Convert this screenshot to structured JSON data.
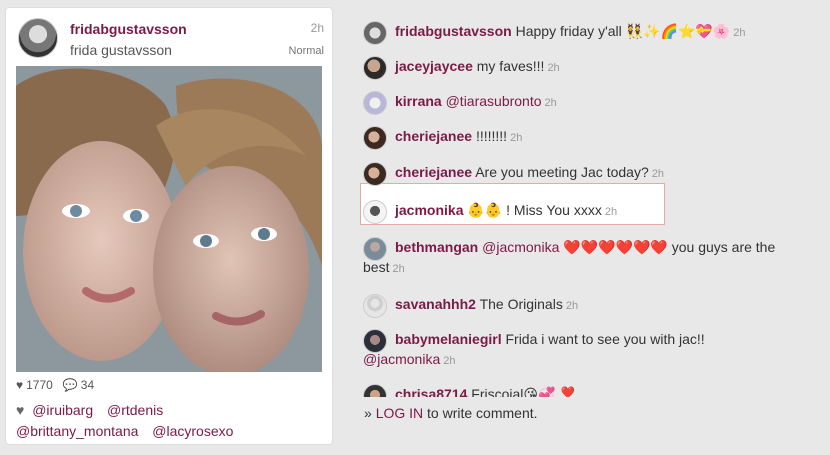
{
  "post": {
    "username": "fridabgustavsson",
    "fullname": "frida gustavsson",
    "time": "2h",
    "filter": "Normal",
    "likes_count": "1770",
    "comments_count": "34",
    "liked_by": [
      "@iruibarg",
      "@rtdenis",
      "@brittany_montana",
      "@lacyrosexo"
    ]
  },
  "comments": [
    {
      "user": "fridabgustavsson",
      "text": "Happy friday y'all 👯✨🌈⭐💝🌸",
      "time": "2h"
    },
    {
      "user": "jaceyjaycee",
      "text": "my faves!!!",
      "time": "2h"
    },
    {
      "user": "kirrana",
      "mention": "@tiarasubronto",
      "text": "",
      "time": "2h"
    },
    {
      "user": "cheriejanee",
      "text": "!!!!!!!!",
      "time": "2h"
    },
    {
      "user": "cheriejanee",
      "text": "Are you meeting Jac today?",
      "time": "2h"
    },
    {
      "user": "jacmonika",
      "text": "👶👶 ! Miss You xxxx",
      "time": "2h"
    },
    {
      "user": "bethmangan",
      "mention": "@jacmonika",
      "text": "❤️❤️❤️❤️❤️❤️ you guys are the",
      "text2": "best",
      "time": "2h"
    },
    {
      "user": "savanahhh2",
      "text": "The Originals",
      "time": "2h"
    },
    {
      "user": "babymelaniegirl",
      "text": "Frida i want to see you with jac!!",
      "mention2": "@jacmonika",
      "time": "2h"
    },
    {
      "user": "chrisa8714",
      "text": "Friscoial😘💞 ❣️",
      "time": ""
    }
  ],
  "login": {
    "prefix": "»",
    "link": "LOG IN",
    "suffix": "to write comment."
  }
}
